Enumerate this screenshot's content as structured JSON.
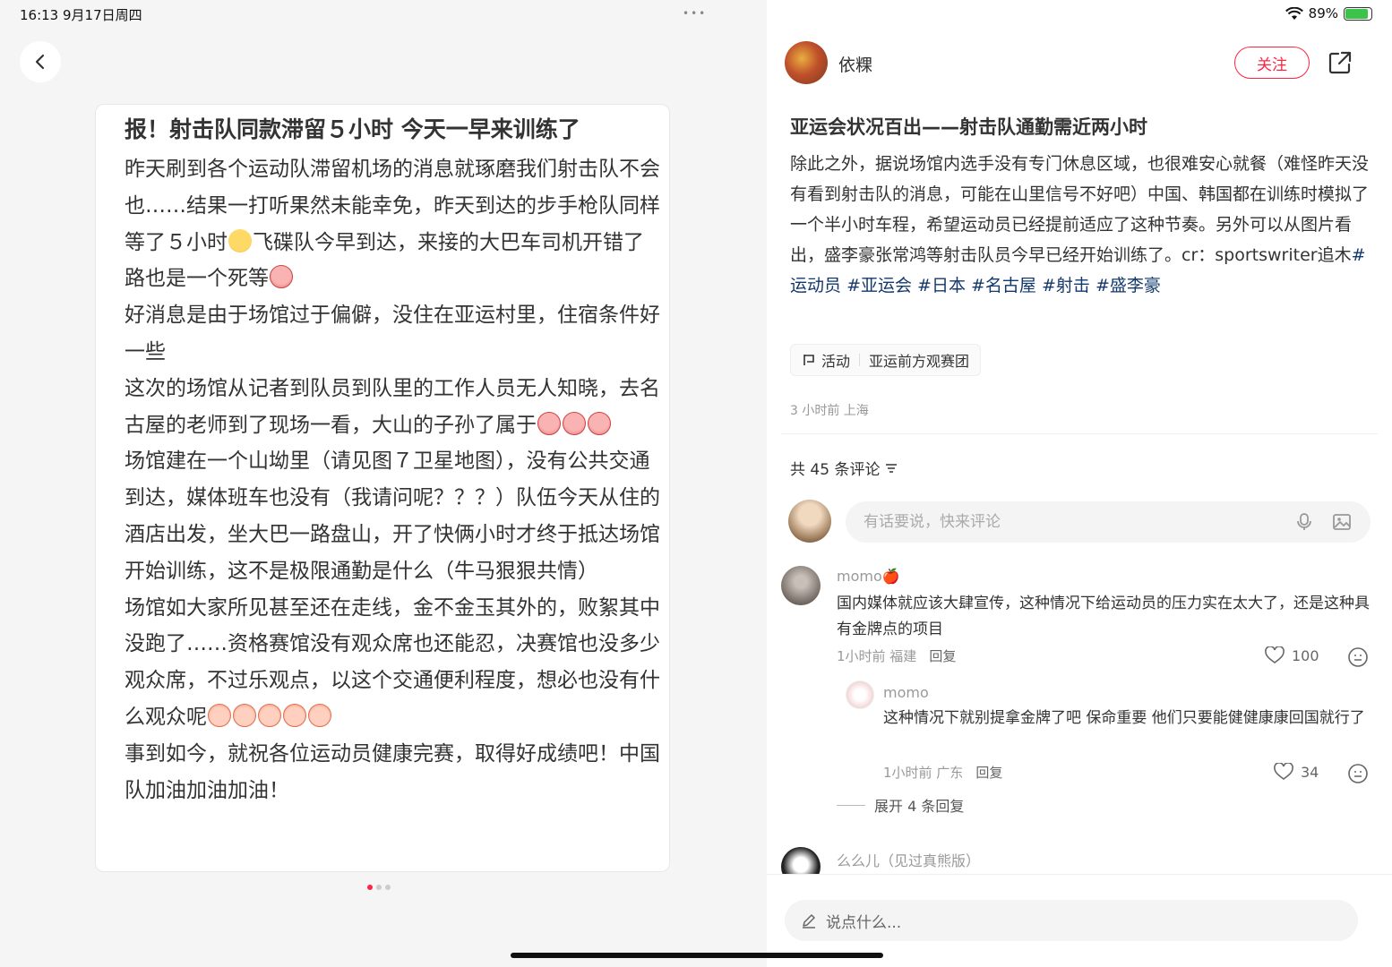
{
  "status": {
    "time_date": "16:13  9月17日周四",
    "more_dots": "•••",
    "battery_percent": "89%",
    "battery_level": 0.89
  },
  "note": {
    "title": "报！射击队同款滞留５小时 今天一早来训练了",
    "p1": "昨天刷到各个运动队滞留机场的消息就琢磨我们射击队不会也……结果一打听果然未能幸免，昨天到达的步手枪队同样等了５小时",
    "p1b": "飞碟队今早到达，来接的大巴车司机开错了路也是一个死等",
    "p2": "好消息是由于场馆过于偏僻，没住在亚运村里，住宿条件好一些",
    "p3": "这次的场馆从记者到队员到队里的工作人员无人知晓，去名古屋的老师到了现场一看，大山的子孙了属于",
    "p4": "场馆建在一个山坳里（请见图７卫星地图），没有公共交通到达，媒体班车也没有（我请问呢？？？）队伍今天从住的酒店出发，坐大巴一路盘山，开了快俩小时才终于抵达场馆开始训练，这不是极限通勤是什么（牛马狠狠共情）",
    "p5": "场馆如大家所见甚至还在走线，金不金玉其外的，败絮其中没跑了……资格赛馆没有观众席也还能忍，决赛馆也没多少观众席，不过乐观点，以这个交通便利程度，想必也没有什么观众呢",
    "p6": "事到如今，就祝各位运动员健康完赛，取得好成绩吧！中国队加油加油加油！",
    "pages": 3,
    "current_page": 1
  },
  "post": {
    "author": "依粿",
    "follow_label": "关注",
    "title": "亚运会状况百出——射击队通勤需近两小时",
    "body": "除此之外，据说场馆内选手没有专门休息区域，也很难安心就餐（难怪昨天没有看到射击队的消息，可能在山里信号不好吧）中国、韩国都在训练时模拟了一个半小时车程，希望运动员已经提前适应了这种节奏。另外可以从图片看出，盛李豪张常鸿等射击队员今早已经开始训练了。cr：sportswriter追木",
    "tags": [
      "#运动员",
      "#亚运会",
      "#日本",
      "#名古屋",
      "#射击",
      "#盛李豪"
    ],
    "activity_label": "活动",
    "activity_name": "亚运前方观赛团",
    "meta": "3 小时前 上海"
  },
  "comments": {
    "count_label": "共 45 条评论",
    "input_placeholder": "有话要说，快来评论",
    "items": [
      {
        "name": "momo🍎",
        "text": "国内媒体就应该大肆宣传，这种情况下给运动员的压力实在太大了，还是这种具有金牌点的项目",
        "meta": "1小时前  福建",
        "reply": "回复",
        "likes": "100"
      },
      {
        "name": "momo",
        "text": "这种情况下就别提拿金牌了吧 保命重要 他们只要能健健康康回国就行了",
        "meta": "1小时前  广东",
        "reply": "回复",
        "likes": "34"
      }
    ],
    "expand_label": "展开 4 条回复",
    "next_name": "么么儿（见过真熊版）"
  },
  "bottom": {
    "say_placeholder": "说点什么..."
  },
  "icons": {
    "back": "back-arrow-icon",
    "share": "share-icon",
    "mic": "microphone-icon",
    "image": "image-icon",
    "heart": "heart-icon",
    "more": "emoji-icon",
    "pen": "pen-icon",
    "sort": "sort-icon"
  },
  "colors": {
    "accent": "#ff2442",
    "tag": "#13386c"
  }
}
